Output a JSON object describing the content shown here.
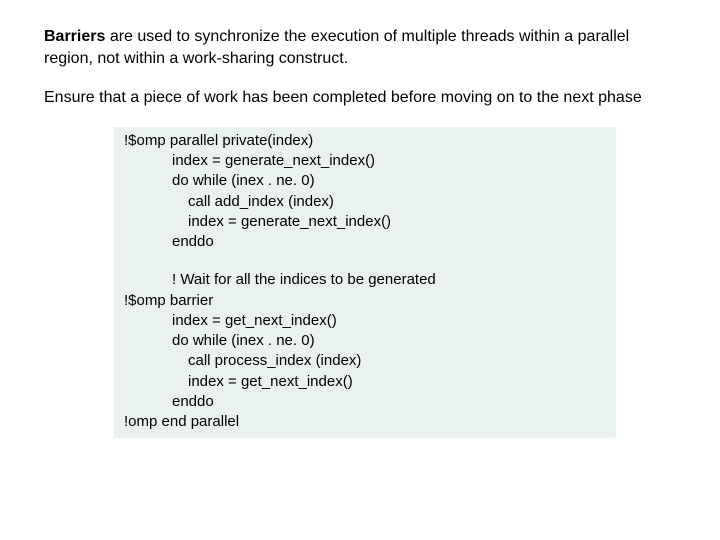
{
  "heading_bold": "Barriers",
  "heading_rest": " are used to synchronize the execution of multiple threads within a parallel region, not within a work-sharing construct.",
  "para2": "Ensure that a piece of work has been completed before moving on to the next phase",
  "code": {
    "l1": "!$omp parallel private(index)",
    "l2": "index = generate_next_index()",
    "l3": "do while (inex . ne. 0)",
    "l4": "call add_index (index)",
    "l5": "index = generate_next_index()",
    "l6": "enddo",
    "l7": "! Wait for all the indices to be generated",
    "l8": "!$omp barrier",
    "l9": "index = get_next_index()",
    "l10": "do while (inex . ne. 0)",
    "l11": "call process_index (index)",
    "l12": "index = get_next_index()",
    "l13": "enddo",
    "l14": "!omp end parallel"
  }
}
